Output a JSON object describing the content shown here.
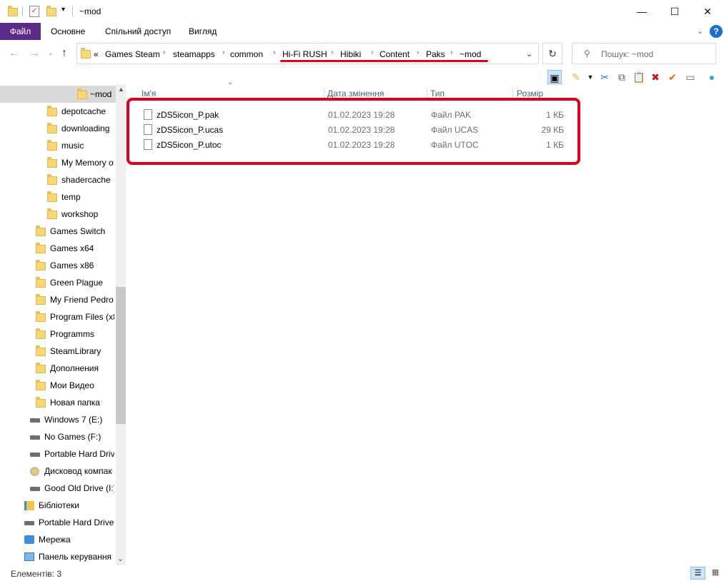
{
  "window": {
    "title": "~mod",
    "minimize": "—",
    "maximize": "☐",
    "close": "✕"
  },
  "ribbon": {
    "tabs": [
      "Файл",
      "Основне",
      "Спільний доступ",
      "Вигляд"
    ],
    "help": "?"
  },
  "address": {
    "overflow": "«",
    "crumbs": [
      "Games Steam",
      "steamapps",
      "common",
      "Hi-Fi RUSH",
      "Hibiki",
      "Content",
      "Paks",
      "~mod"
    ]
  },
  "search": {
    "placeholder": "Пошук: ~mod"
  },
  "sidebar": {
    "items": [
      {
        "label": "~mod",
        "type": "folder",
        "selected": true
      },
      {
        "label": "depotcache",
        "type": "folder"
      },
      {
        "label": "downloading",
        "type": "folder"
      },
      {
        "label": "music",
        "type": "folder"
      },
      {
        "label": "My Memory o",
        "type": "folder"
      },
      {
        "label": "shadercache",
        "type": "folder"
      },
      {
        "label": "temp",
        "type": "folder"
      },
      {
        "label": "workshop",
        "type": "folder"
      },
      {
        "label": "Games Switch",
        "type": "folder"
      },
      {
        "label": "Games x64",
        "type": "folder"
      },
      {
        "label": "Games x86",
        "type": "folder"
      },
      {
        "label": "Green Plague",
        "type": "folder"
      },
      {
        "label": "My Friend Pedro",
        "type": "folder"
      },
      {
        "label": "Program Files (x8",
        "type": "folder"
      },
      {
        "label": "Programms",
        "type": "folder"
      },
      {
        "label": "SteamLibrary",
        "type": "folder"
      },
      {
        "label": "Дополнения",
        "type": "folder"
      },
      {
        "label": "Мои Видео",
        "type": "folder"
      },
      {
        "label": "Новая папка",
        "type": "folder"
      },
      {
        "label": "Windows 7 (E:)",
        "type": "drive"
      },
      {
        "label": "No Games (F:)",
        "type": "drive"
      },
      {
        "label": "Portable Hard Driv",
        "type": "drive"
      },
      {
        "label": "Дисковод компак",
        "type": "cd"
      },
      {
        "label": "Good Old Drive (I:)",
        "type": "drive"
      },
      {
        "label": "Бібліотеки",
        "type": "library"
      },
      {
        "label": "Portable Hard Drive",
        "type": "drive"
      },
      {
        "label": "Мережа",
        "type": "network"
      },
      {
        "label": "Панель керування",
        "type": "control"
      }
    ]
  },
  "columns": [
    "Ім'я",
    "Дата змінення",
    "Тип",
    "Розмір"
  ],
  "files": [
    {
      "name": "zDS5icon_P.pak",
      "date": "01.02.2023 19:28",
      "type": "Файл PAK",
      "size": "1 КБ"
    },
    {
      "name": "zDS5icon_P.ucas",
      "date": "01.02.2023 19:28",
      "type": "Файл UCAS",
      "size": "29 КБ"
    },
    {
      "name": "zDS5icon_P.utoc",
      "date": "01.02.2023 19:28",
      "type": "Файл UTOC",
      "size": "1 КБ"
    }
  ],
  "status": {
    "count": "Елементів: 3"
  },
  "colors": {
    "file_tab": "#5b2d88",
    "highlight": "#e0001a",
    "header_text": "#4c607a"
  }
}
